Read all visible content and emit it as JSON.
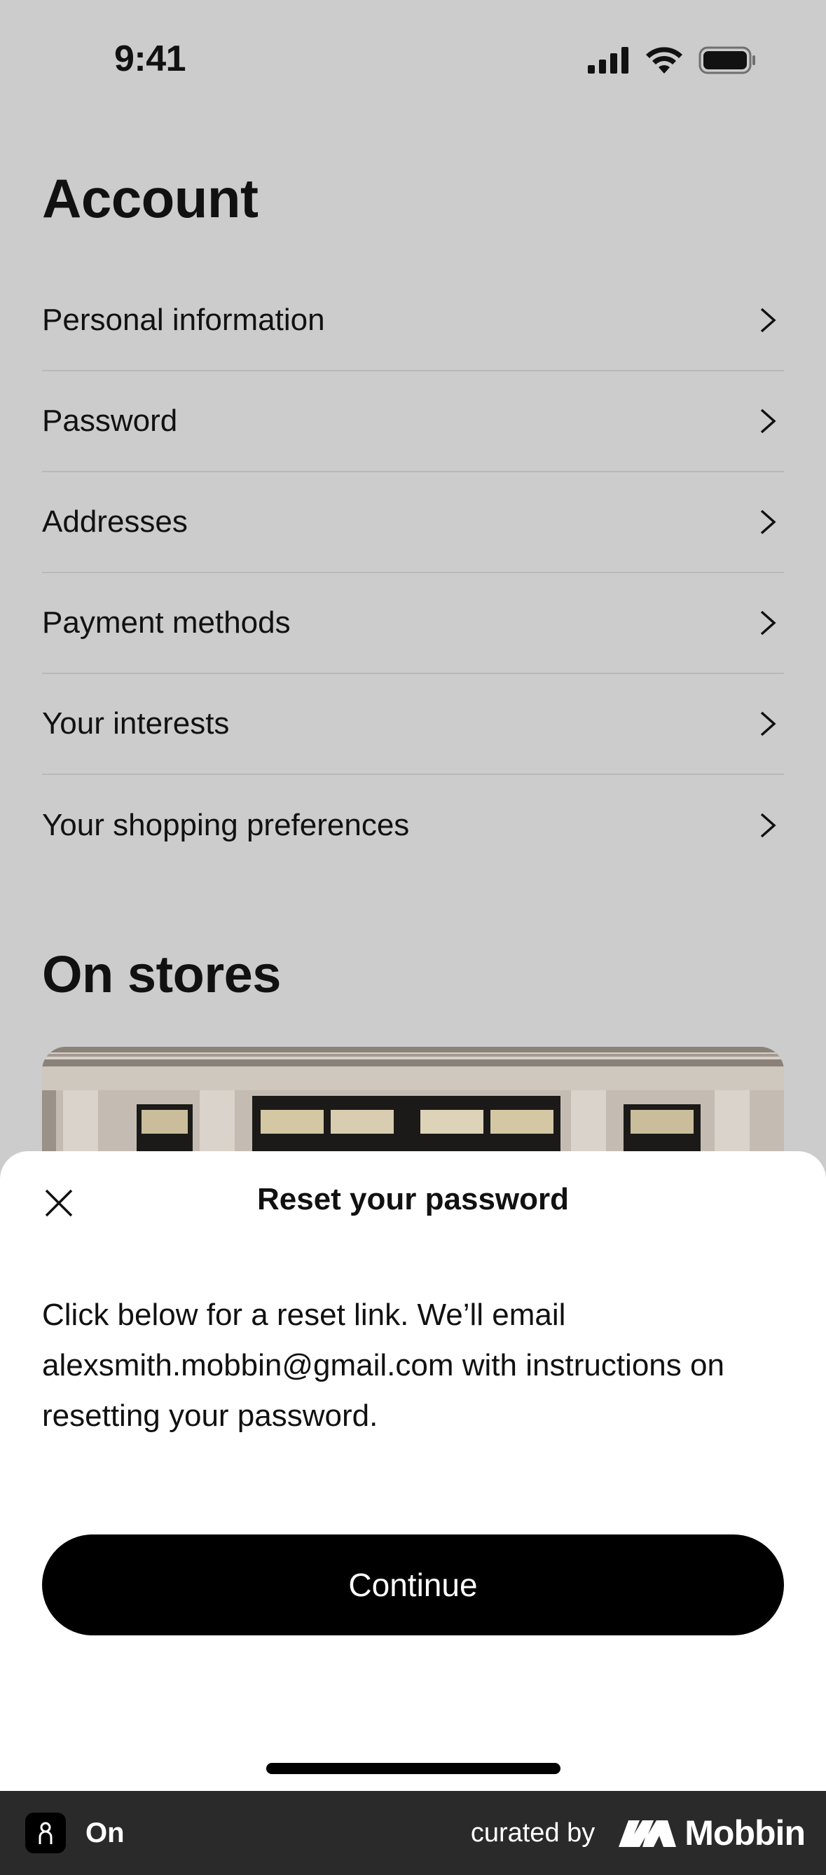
{
  "status_bar": {
    "time": "9:41"
  },
  "account": {
    "title": "Account",
    "items": [
      {
        "label": "Personal information"
      },
      {
        "label": "Password"
      },
      {
        "label": "Addresses"
      },
      {
        "label": "Payment methods"
      },
      {
        "label": "Your interests"
      },
      {
        "label": "Your shopping preferences"
      }
    ]
  },
  "stores": {
    "title": "On stores"
  },
  "sheet": {
    "title": "Reset your password",
    "body": "Click below for a reset link. We’ll email alexsmith.mobbin@gmail.com with instructions on resetting your password.",
    "continue_label": "Continue"
  },
  "footer": {
    "app_name": "On",
    "curated_by": "curated by",
    "brand": "Mobbin"
  },
  "colors": {
    "background_dim": "#cccccc",
    "sheet_bg": "#ffffff",
    "button_bg": "#000000",
    "footer_bg": "#2a2a2a"
  }
}
